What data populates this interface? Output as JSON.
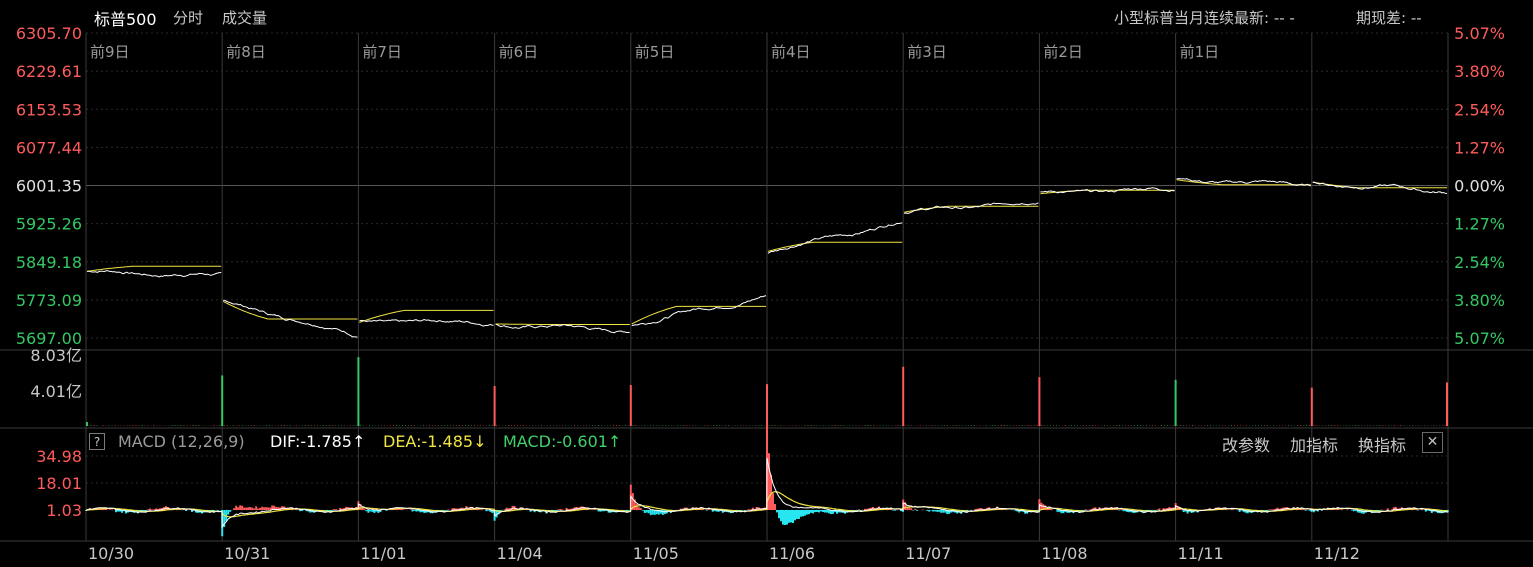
{
  "header": {
    "title": "标普500",
    "tabs": [
      "分时",
      "成交量"
    ],
    "futures_label": "小型标普当月连续最新: --  -",
    "basis_label": "期现差: --"
  },
  "colors": {
    "up": "#ff5b5b",
    "down": "#33c864",
    "price_line": "#ffffff",
    "avg_line": "#f0e442",
    "dif_line": "#ffffff",
    "dea_line": "#f0e442",
    "grid": "#2a2a2a",
    "macd_neg": "#27e6f0"
  },
  "chart_data": [
    {
      "type": "line",
      "title": "标普500 分时",
      "day_labels": [
        "前9日",
        "前8日",
        "前7日",
        "前6日",
        "前5日",
        "前4日",
        "前3日",
        "前2日",
        "前1日"
      ],
      "y_ticks_left": [
        "6305.70",
        "6229.61",
        "6153.53",
        "6077.44",
        "6001.35",
        "5925.26",
        "5849.18",
        "5773.09",
        "5697.00"
      ],
      "y_ticks_right": [
        "5.07%",
        "3.80%",
        "2.54%",
        "1.27%",
        "0.00%",
        "1.27%",
        "2.54%",
        "3.80%",
        "5.07%"
      ],
      "ylim": [
        5697.0,
        6305.7
      ],
      "base": 6001.35,
      "x_dates": [
        "10/30",
        "10/31",
        "11/01",
        "11/04",
        "11/05",
        "11/06",
        "11/07",
        "11/08",
        "11/11",
        "11/12"
      ],
      "daily": [
        {
          "open": 5830,
          "close": 5822,
          "avg": 5840,
          "min": 5818,
          "max": 5853
        },
        {
          "open": 5770,
          "close": 5705,
          "avg": 5735,
          "min": 5699,
          "max": 5772
        },
        {
          "open": 5728,
          "close": 5729,
          "avg": 5752,
          "min": 5720,
          "max": 5773
        },
        {
          "open": 5725,
          "close": 5712,
          "avg": 5724,
          "min": 5690,
          "max": 5745
        },
        {
          "open": 5725,
          "close": 5782,
          "avg": 5760,
          "min": 5722,
          "max": 5785
        },
        {
          "open": 5870,
          "close": 5930,
          "avg": 5888,
          "min": 5860,
          "max": 5935
        },
        {
          "open": 5948,
          "close": 5970,
          "avg": 5960,
          "min": 5945,
          "max": 5975
        },
        {
          "open": 5985,
          "close": 5996,
          "avg": 5992,
          "min": 5983,
          "max": 6012
        },
        {
          "open": 6013,
          "close": 6002,
          "avg": 6003,
          "min": 5995,
          "max": 6015
        },
        {
          "open": 6008,
          "close": 5990,
          "avg": 5997,
          "min": 5965,
          "max": 6008
        }
      ]
    },
    {
      "type": "bar",
      "title": "成交量",
      "y_ticks": [
        "8.03亿",
        "4.01亿"
      ],
      "ylim": [
        0,
        8.03
      ],
      "unit": "亿",
      "open_spikes": [
        {
          "value": 0.45,
          "dir": "down"
        },
        {
          "value": 5.8,
          "dir": "down"
        },
        {
          "value": 7.9,
          "dir": "down"
        },
        {
          "value": 4.6,
          "dir": "up"
        },
        {
          "value": 4.7,
          "dir": "up"
        },
        {
          "value": 4.8,
          "dir": "up"
        },
        {
          "value": 6.8,
          "dir": "up"
        },
        {
          "value": 5.6,
          "dir": "up"
        },
        {
          "value": 5.3,
          "dir": "down"
        },
        {
          "value": 4.4,
          "dir": "up"
        }
      ],
      "last_spike": {
        "value": 5.0,
        "dir": "up"
      }
    },
    {
      "type": "line",
      "title": "MACD (12,26,9)",
      "indicator": {
        "name": "MACD (12,26,9)",
        "dif": "DIF:-1.785↑",
        "dea": "DEA:-1.485↓",
        "macd": "MACD:-0.601↑",
        "actions": [
          "改参数",
          "加指标",
          "换指标"
        ]
      },
      "y_ticks": [
        "34.98",
        "18.01",
        "1.03"
      ],
      "ylim": [
        -10,
        34.98
      ],
      "day_open_shocks": [
        0,
        -12,
        5,
        -3,
        7,
        33,
        5,
        2,
        3,
        1
      ]
    }
  ]
}
